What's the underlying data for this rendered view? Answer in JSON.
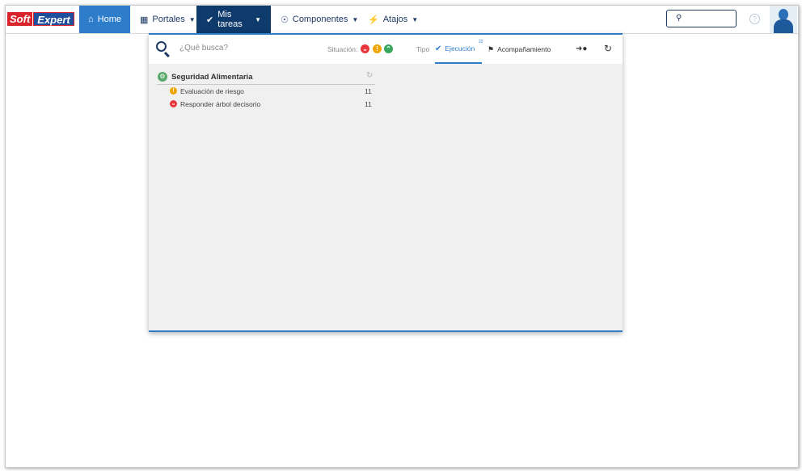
{
  "brand": {
    "soft": "Soft",
    "expert": "Expert"
  },
  "nav": {
    "home": "Home",
    "portales": "Portales",
    "mis_tareas": "Mis tareas",
    "componentes": "Componentes",
    "atajos": "Atajos"
  },
  "icons": {
    "home": "home-icon",
    "portales": "dashboard-icon",
    "mis_tareas": "check-icon",
    "componentes": "trophy-icon",
    "atajos": "lightning-icon"
  },
  "colors": {
    "accent": "#2d7dcb",
    "nav_active": "#0e3a6c",
    "status_red": "#e8363c",
    "status_yellow": "#f0a400",
    "status_green": "#3aa75d"
  },
  "panel": {
    "search_placeholder": "¿Qué busca?",
    "situacion_label": "Situación:",
    "tipo_label": "Tipo",
    "tab_ejecucion": "Ejecución",
    "tab_ejecucion_badge": "22",
    "tab_acompanamiento": "Acompañamiento"
  },
  "group": {
    "title": "Seguridad Alimentaria",
    "items": [
      {
        "label": "Evaluación de riesgo",
        "count": "11",
        "status": "yellow"
      },
      {
        "label": "Responder árbol decisorio",
        "count": "11",
        "status": "red"
      }
    ]
  }
}
